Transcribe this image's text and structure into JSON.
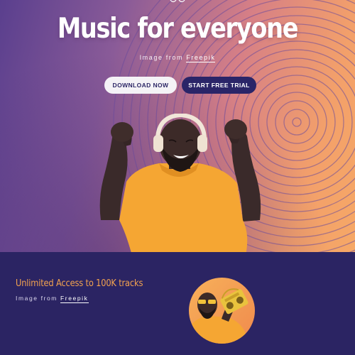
{
  "hero": {
    "title": "Music for everyone",
    "credit_prefix": "Image from",
    "credit_link": "Freepik",
    "buttons": {
      "download": "DOWNLOAD NOW",
      "trial": "START FREE TRIAL"
    },
    "image": "man-with-headphones-dancing"
  },
  "feature": {
    "title": "Unlimited Access to 100K tracks",
    "credit_prefix": "Image from",
    "credit_link": "Freepik",
    "image": "man-with-boombox-circle"
  },
  "colors": {
    "accent_orange": "#f3a34f",
    "navy": "#2b2463",
    "button_dark": "#2a2568",
    "button_light": "#f4f2f6"
  }
}
